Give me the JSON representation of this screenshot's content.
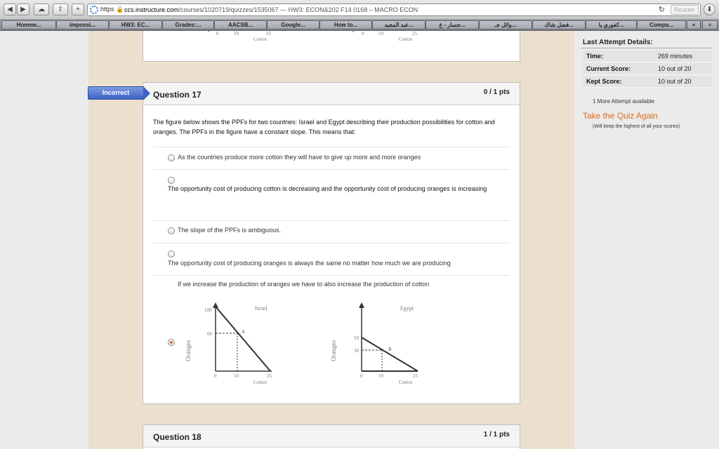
{
  "browser": {
    "url_scheme": "https",
    "url_host": "ccs.instructure.com",
    "url_path": "/courses/1020719/quizzes/1535067",
    "page_title": " — HW3: ECON&202 F14 0168 – MACRO ECON",
    "reader_label": "Reader",
    "add_tab_label": "+",
    "bookmarks": [
      "Homew...",
      "impossi...",
      "HW3: EC...",
      "Grades:...",
      "AACSB...",
      "Google...",
      "How to...",
      "عبد المجيد...",
      "جسار - غ...",
      "وائل جـ...",
      "فضل شاك...",
      "كفوري يا...",
      "Compa...",
      "+"
    ]
  },
  "question17": {
    "tag": "Incorrect",
    "title": "Question 17",
    "points": "0 / 1 pts",
    "text": "The figure below shows the PPFs for two countries: Israel and Egypt describing their production possibilities for cotton and oranges. The PPFs in the figure have a constant slope. This means that:",
    "answers": [
      "As the countries produce more cotton they will have to give up more and more oranges",
      "The opportunity cost of producing cotton is decreasing and the opportunity cost of producing oranges is increasing",
      "The slope of the PPFs is ambiguous.",
      "The opportunity cost of producing oranges is always the same no matter how much we are producing",
      "If we increase the production of oranges we have to also increase the production of cotton"
    ],
    "selected_answer_index": 4
  },
  "graphs": {
    "israel": {
      "title": "Israel",
      "ylabel": "Oranges",
      "xlabel": "Cotton",
      "y_ticks": [
        "100",
        "60"
      ],
      "x_ticks": [
        "0",
        "10",
        "25"
      ],
      "point": "A"
    },
    "egypt": {
      "title": "Egypt",
      "ylabel": "Oranges",
      "xlabel": "Cotton",
      "y_ticks": [
        "50",
        "30"
      ],
      "x_ticks": [
        "0",
        "10",
        "25"
      ],
      "point": "B"
    },
    "top_fragment": {
      "left_ticks": [
        "0",
        "10",
        "25"
      ],
      "left_label": "Cotton",
      "right_ticks": [
        "0",
        "10",
        "25"
      ],
      "right_label": "Cotton"
    }
  },
  "question18": {
    "title": "Question 18",
    "points": "1 / 1 pts"
  },
  "sidebar": {
    "title": "Last Attempt Details:",
    "rows": [
      {
        "label": "Time:",
        "value": "269 minutes"
      },
      {
        "label": "Current Score:",
        "value": "10 out of 20"
      },
      {
        "label": "Kept Score:",
        "value": "10 out of 20"
      }
    ],
    "attempts": "1 More Attempt available",
    "retake": "Take the Quiz Again",
    "note": "(Will keep the highest of all your scores)"
  },
  "colors": {
    "accent_orange": "#e06a1b",
    "incorrect_blue": "#3d63c7"
  }
}
